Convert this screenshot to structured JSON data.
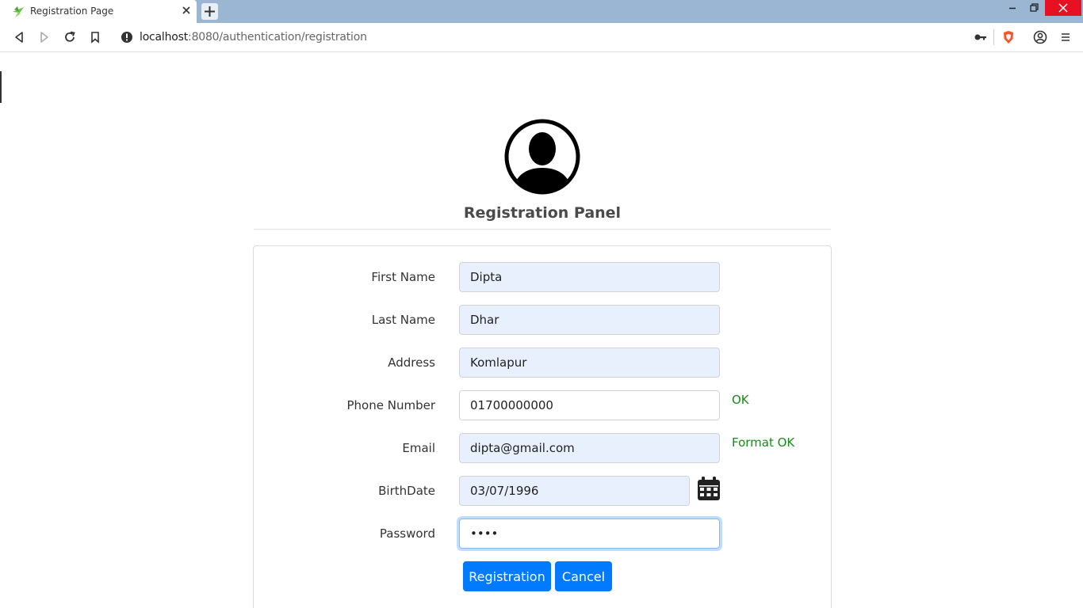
{
  "browser": {
    "tab_title": "Registration Page",
    "url_host": "localhost",
    "url_path": ":8080/authentication/registration"
  },
  "page": {
    "title": "Registration Panel"
  },
  "form": {
    "first_name": {
      "label": "First Name",
      "value": "Dipta"
    },
    "last_name": {
      "label": "Last Name",
      "value": "Dhar"
    },
    "address": {
      "label": "Address",
      "value": "Komlapur"
    },
    "phone": {
      "label": "Phone Number",
      "value": "01700000000",
      "status": "OK"
    },
    "email": {
      "label": "Email",
      "value": "dipta@gmail.com",
      "status": "Format OK"
    },
    "birthdate": {
      "label": "BirthDate",
      "value": "03/07/1996"
    },
    "password": {
      "label": "Password",
      "value": "••••"
    }
  },
  "buttons": {
    "register": "Registration",
    "cancel": "Cancel"
  },
  "colors": {
    "primary": "#007bff",
    "success_text": "#1a8a1a",
    "autofill_bg": "#e8f0fe",
    "tabbar": "#9ab6d3",
    "close_button": "#e81123"
  }
}
